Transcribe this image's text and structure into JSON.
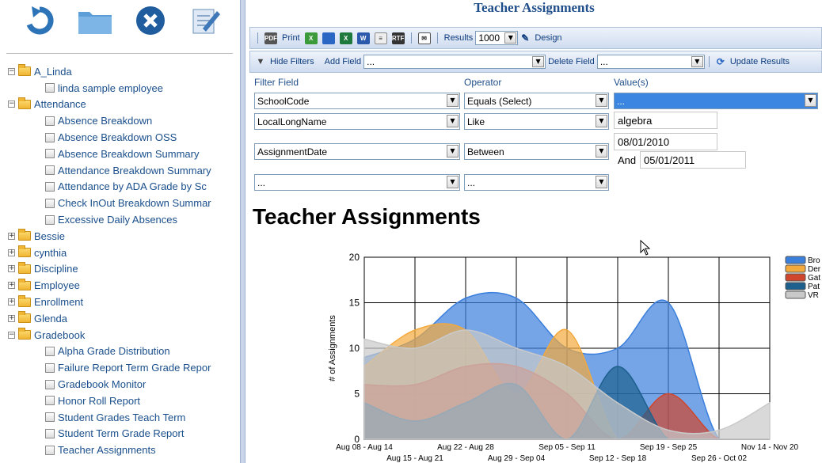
{
  "toolbar_icons": [
    "refresh-icon",
    "folder-icon",
    "close-icon",
    "edit-icon"
  ],
  "tree": [
    {
      "type": "folder",
      "label": "A_Linda",
      "expanded": true
    },
    {
      "type": "report",
      "label": "linda sample employee"
    },
    {
      "type": "folder",
      "label": "Attendance",
      "expanded": true
    },
    {
      "type": "report",
      "label": "Absence Breakdown"
    },
    {
      "type": "report",
      "label": "Absence Breakdown OSS"
    },
    {
      "type": "report",
      "label": "Absence Breakdown Summary"
    },
    {
      "type": "report",
      "label": "Attendance Breakdown Summary"
    },
    {
      "type": "report",
      "label": "Attendance by ADA Grade by Sc"
    },
    {
      "type": "report",
      "label": "Check InOut Breakdown Summar"
    },
    {
      "type": "report",
      "label": "Excessive Daily Absences"
    },
    {
      "type": "folder",
      "label": "Bessie",
      "expanded": false
    },
    {
      "type": "folder",
      "label": "cynthia",
      "expanded": false
    },
    {
      "type": "folder",
      "label": "Discipline",
      "expanded": false
    },
    {
      "type": "folder",
      "label": "Employee",
      "expanded": false
    },
    {
      "type": "folder",
      "label": "Enrollment",
      "expanded": false
    },
    {
      "type": "folder",
      "label": "Glenda",
      "expanded": false
    },
    {
      "type": "folder",
      "label": "Gradebook",
      "expanded": true
    },
    {
      "type": "report",
      "label": "Alpha Grade Distribution"
    },
    {
      "type": "report",
      "label": "Failure Report Term Grade Repor"
    },
    {
      "type": "report",
      "label": "Gradebook Monitor"
    },
    {
      "type": "report",
      "label": "Honor Roll Report"
    },
    {
      "type": "report",
      "label": "Student Grades Teach Term"
    },
    {
      "type": "report",
      "label": "Student Term Grade Report"
    },
    {
      "type": "report",
      "label": "Teacher Assignments"
    }
  ],
  "header": {
    "title": "Teacher Assignments"
  },
  "toolbar1": {
    "print_label": "Print",
    "results_label": "Results",
    "results_value": "1000",
    "design_label": "Design"
  },
  "toolbar2": {
    "hide_filters_label": "Hide Filters",
    "add_field_label": "Add Field",
    "add_field_value": "...",
    "delete_field_label": "Delete Field",
    "delete_field_value": "...",
    "update_label": "Update Results"
  },
  "filters": {
    "headers": {
      "field": "Filter Field",
      "operator": "Operator",
      "values": "Value(s)"
    },
    "row1": {
      "field": "SchoolCode",
      "operator": "Equals (Select)",
      "value": "..."
    },
    "row2": {
      "field": "LocalLongName",
      "operator": "Like",
      "value": "algebra"
    },
    "row3": {
      "field": "AssignmentDate",
      "operator": "Between",
      "value1": "08/01/2010",
      "and_label": "And",
      "value2": "05/01/2011"
    },
    "row4": {
      "field": "...",
      "operator": "..."
    }
  },
  "report_title": "Teacher Assignments",
  "chart_data": {
    "type": "area",
    "ylabel": "# of Assignments",
    "ylim": [
      0,
      20
    ],
    "yticks": [
      0,
      5,
      10,
      15,
      20
    ],
    "categories": [
      "Aug 08 - Aug 14",
      "Aug 15 - Aug 21",
      "Aug 22 - Aug 28",
      "Aug 29 - Sep 04",
      "Sep 05 - Sep 11",
      "Sep 12 - Sep 18",
      "Sep 19 - Sep 25",
      "Sep 26 - Oct 02",
      "Nov 14 - Nov 20"
    ],
    "grid": true,
    "legend_position": "right",
    "series": [
      {
        "name": "Bro",
        "color": "#3a7fdc",
        "values": [
          9,
          11,
          15.5,
          15.5,
          10,
          10,
          15,
          0,
          0
        ]
      },
      {
        "name": "Der",
        "color": "#f3a93c",
        "values": [
          8,
          12,
          12,
          5,
          12,
          0,
          0,
          0,
          0
        ]
      },
      {
        "name": "Gat",
        "color": "#d0462c",
        "values": [
          6,
          6,
          8,
          8,
          5,
          0,
          5,
          0,
          0
        ]
      },
      {
        "name": "Pat",
        "color": "#1d5f8d",
        "values": [
          4,
          2,
          4,
          6,
          0,
          8,
          0,
          0,
          0
        ]
      },
      {
        "name": "VR",
        "color": "#c9c9c9",
        "values": [
          11,
          10,
          12,
          10,
          8,
          4,
          1,
          1,
          4
        ]
      }
    ]
  }
}
